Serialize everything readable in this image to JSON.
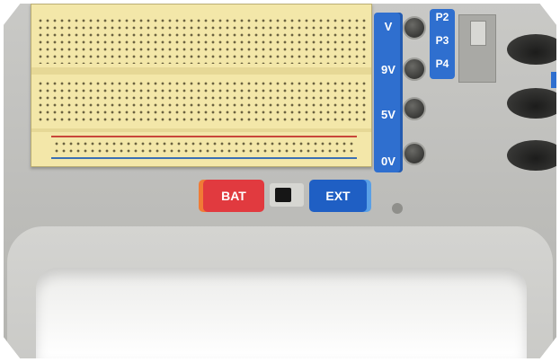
{
  "board": {
    "voltage_labels": [
      "V",
      "9V",
      "5V",
      "0V"
    ],
    "port_labels": [
      "P2",
      "P3",
      "P4"
    ],
    "switch": {
      "left_label": "BAT",
      "right_label": "EXT",
      "position": "EXT"
    }
  },
  "colors": {
    "breadboard": "#f3e7a9",
    "voltage_strip": "#2f6fcf",
    "bat_button": "#e13a3f",
    "ext_button": "#1f5fc4",
    "board_body": "#c9c9c6"
  }
}
